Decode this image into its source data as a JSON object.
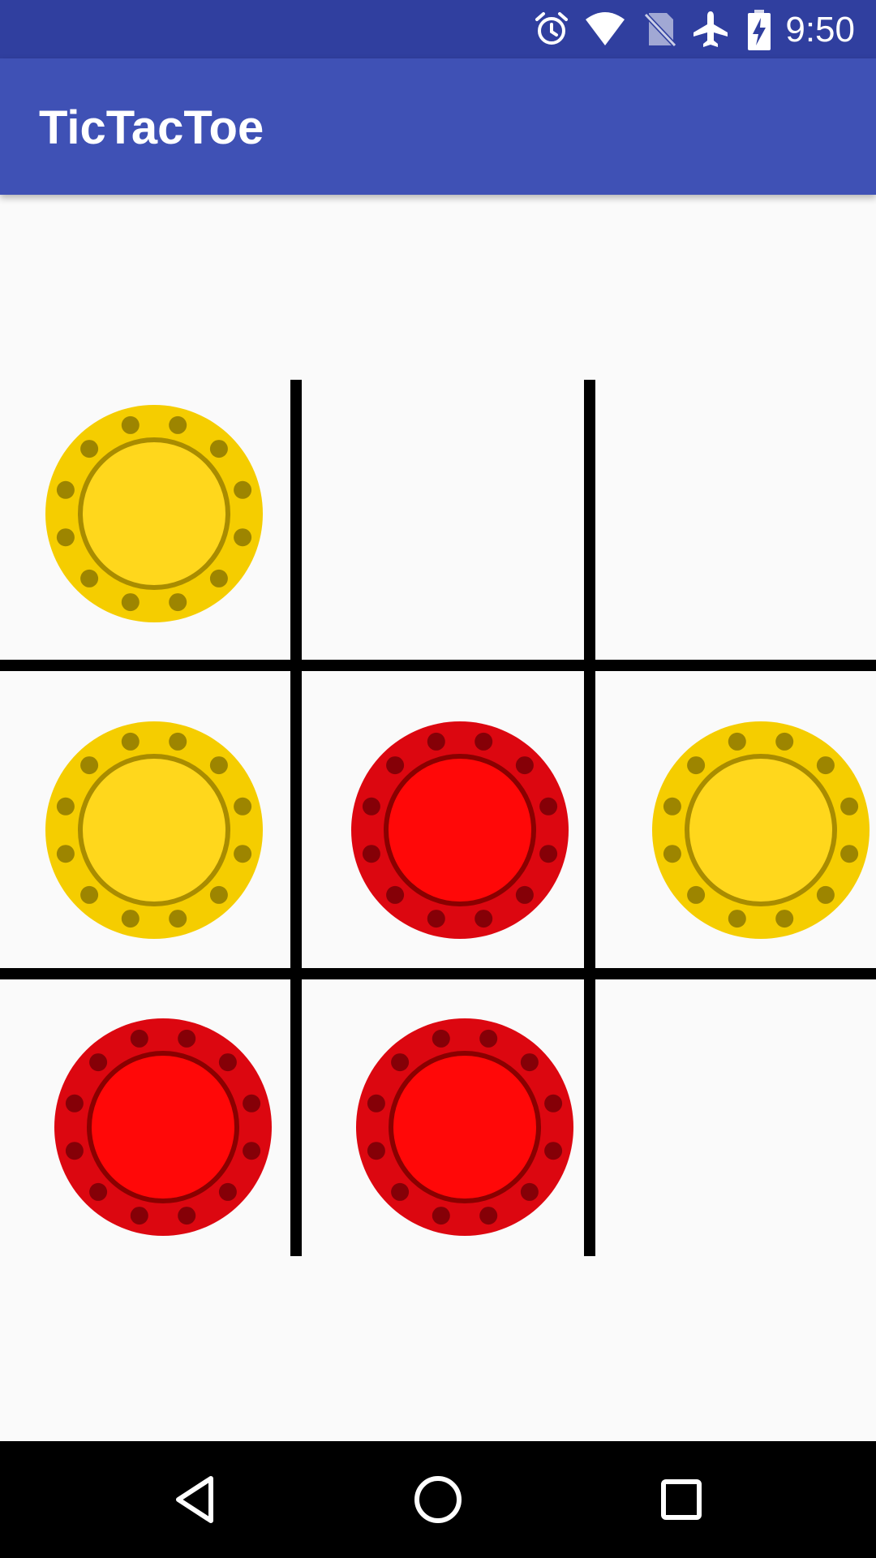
{
  "status_bar": {
    "time": "9:50",
    "icons": [
      "alarm-icon",
      "wifi-icon",
      "no-sim-icon",
      "airplane-mode-icon",
      "battery-charging-icon"
    ]
  },
  "app_bar": {
    "title": "TicTacToe"
  },
  "board": {
    "rows": 3,
    "cols": 3,
    "cells": [
      [
        "yellow",
        "",
        ""
      ],
      [
        "yellow",
        "red",
        "yellow"
      ],
      [
        "red",
        "red",
        ""
      ]
    ]
  },
  "colors": {
    "status_bar": "#303f9f",
    "app_bar": "#3f51b5",
    "background": "#fafafa",
    "yellow_piece": "#ffd71c",
    "red_piece": "#ff0808",
    "grid": "#000000"
  },
  "nav_bar": {
    "icons": [
      "back-icon",
      "home-icon",
      "recents-icon"
    ]
  }
}
